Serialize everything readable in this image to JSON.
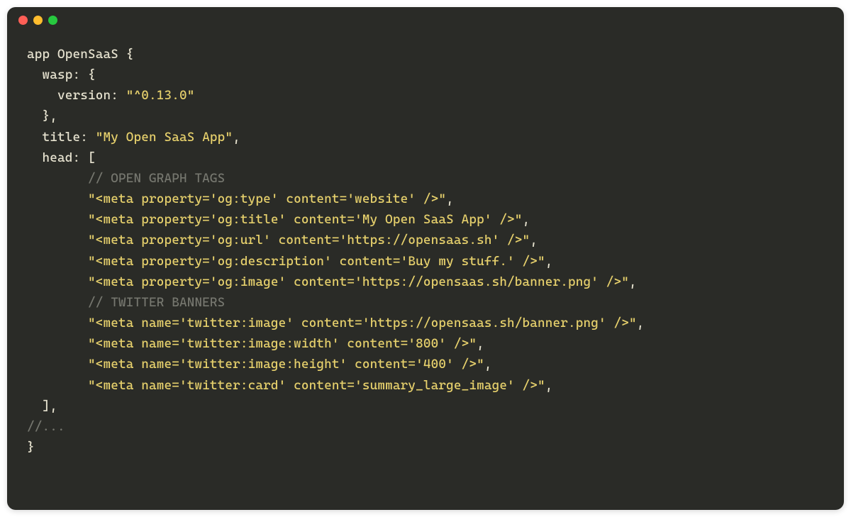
{
  "code": {
    "appKeyword": "app",
    "appName": "OpenSaaS",
    "openBrace": "{",
    "waspKey": "wasp:",
    "waspOpen": "{",
    "versionKey": "version:",
    "versionVal": "\"^0.13.0\"",
    "waspClose": "},",
    "titleKey": "title:",
    "titleVal": "\"My Open SaaS App\"",
    "titleComma": ",",
    "headKey": "head:",
    "headOpen": "[",
    "comment1": "// OPEN GRAPH TAGS",
    "meta1": "\"<meta property='og:type' content='website' />\"",
    "meta2": "\"<meta property='og:title' content='My Open SaaS App' />\"",
    "meta3": "\"<meta property='og:url' content='https://opensaas.sh' />\"",
    "meta4": "\"<meta property='og:description' content='Buy my stuff.' />\"",
    "meta5": "\"<meta property='og:image' content='https://opensaas.sh/banner.png' />\"",
    "comment2": "// TWITTER BANNERS",
    "meta6": "\"<meta name='twitter:image' content='https://opensaas.sh/banner.png' />\"",
    "meta7": "\"<meta name='twitter:image:width' content='800' />\"",
    "meta8": "\"<meta name='twitter:image:height' content='400' />\"",
    "meta9": "\"<meta name='twitter:card' content='summary_large_image' />\"",
    "comma": ",",
    "headClose": "],",
    "ellipsis": "//...",
    "closeBrace": "}"
  }
}
